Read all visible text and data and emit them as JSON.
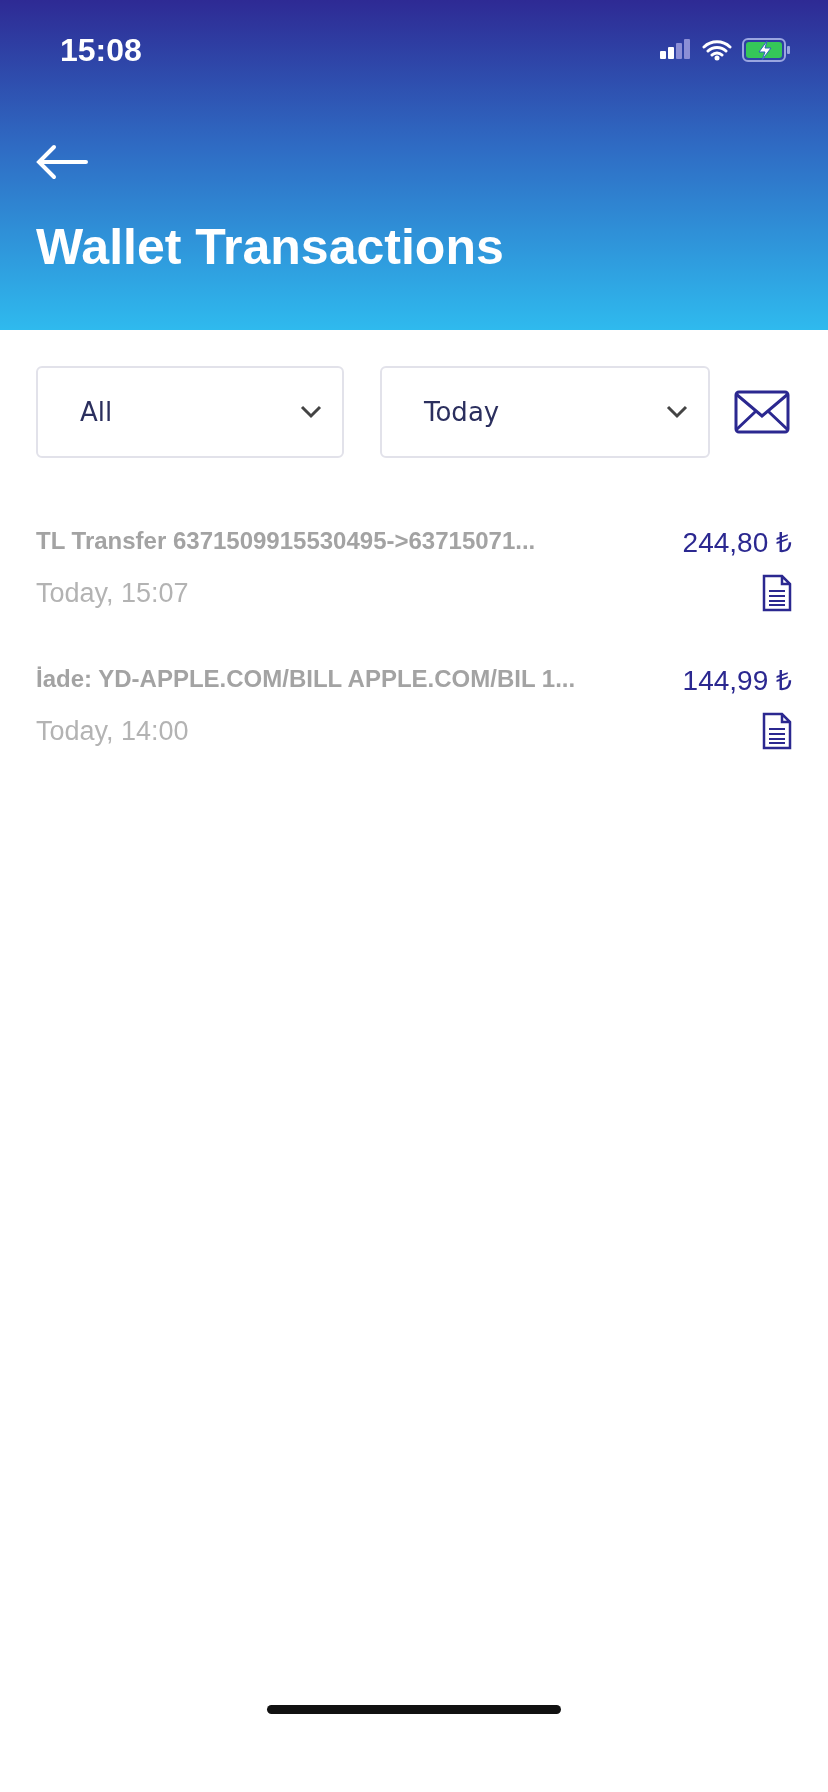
{
  "status_bar": {
    "time": "15:08"
  },
  "header": {
    "title": "Wallet Transactions"
  },
  "filters": [
    {
      "value": "All"
    },
    {
      "value": "Today"
    }
  ],
  "transactions": [
    {
      "description": "TL Transfer 6371509915530495->63715071...",
      "date": "Today, 15:07",
      "amount": "244,80 ₺"
    },
    {
      "description": "İade: YD-APPLE.COM/BILL APPLE.COM/BIL 1...",
      "date": "Today, 14:00",
      "amount": "144,99 ₺"
    }
  ]
}
